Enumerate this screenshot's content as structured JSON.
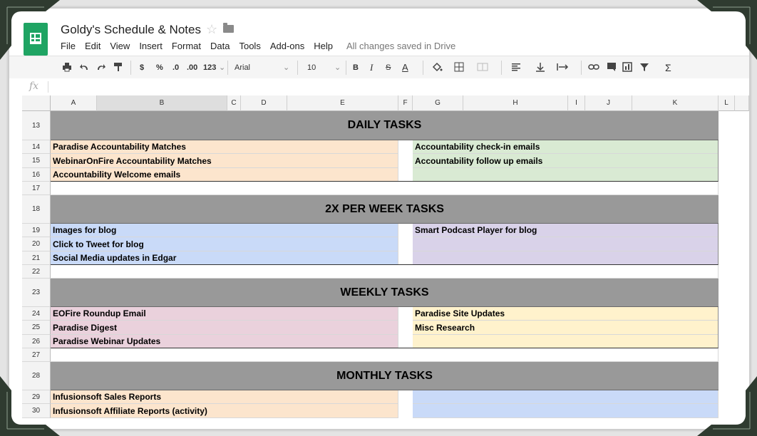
{
  "doc": {
    "title": "Goldy's Schedule & Notes",
    "saved_status": "All changes saved in Drive",
    "star": "☆"
  },
  "menu": [
    "File",
    "Edit",
    "View",
    "Insert",
    "Format",
    "Data",
    "Tools",
    "Add-ons",
    "Help"
  ],
  "toolbar": {
    "currency": "$",
    "percent": "%",
    "dec_less": ".0",
    "dec_more": ".00",
    "number_format": "123",
    "font": "Arial",
    "font_size": "10",
    "bold": "B",
    "italic": "I",
    "strike": "S",
    "text_color": "A",
    "sum": "Σ"
  },
  "formula_bar": {
    "fx": "fx",
    "value": ""
  },
  "columns": [
    "A",
    "B",
    "C",
    "D",
    "E",
    "F",
    "G",
    "H",
    "I",
    "J",
    "K",
    "L"
  ],
  "rows": {
    "r13": "13",
    "r14": "14",
    "r15": "15",
    "r16": "16",
    "r17": "17",
    "r18": "18",
    "r19": "19",
    "r20": "20",
    "r21": "21",
    "r22": "22",
    "r23": "23",
    "r24": "24",
    "r25": "25",
    "r26": "26",
    "r27": "27",
    "r28": "28",
    "r29": "29",
    "r30": "30"
  },
  "sections": {
    "daily": "DAILY TASKS",
    "twice_weekly": "2X PER WEEK TASKS",
    "weekly": "WEEKLY TASKS",
    "monthly": "MONTHLY TASKS"
  },
  "tasks": {
    "daily_left": [
      "Paradise Accountability Matches",
      "WebinarOnFire Accountability Matches",
      "Accountability Welcome emails"
    ],
    "daily_right": [
      "Accountability check-in emails",
      "Accountability follow up emails",
      ""
    ],
    "twice_left": [
      "Images for blog",
      "Click to Tweet for blog",
      "Social Media updates in Edgar"
    ],
    "twice_right": [
      "Smart Podcast Player for blog",
      "",
      ""
    ],
    "weekly_left": [
      "EOFire Roundup Email",
      "Paradise Digest",
      "Paradise Webinar Updates"
    ],
    "weekly_right": [
      "Paradise Site Updates",
      "Misc Research",
      ""
    ],
    "monthly_left": [
      "Infusionsoft Sales Reports",
      "Infusionsoft Affiliate Reports (activity)"
    ],
    "monthly_right": [
      "",
      ""
    ]
  },
  "colors": {
    "app_green": "#1fa463",
    "section_gray": "#999999",
    "orange": "#fce5cd",
    "green": "#d9ead3",
    "blue": "#c9daf8",
    "purple": "#d9d2e9",
    "pink": "#ead1dc",
    "yellow": "#fff2cc",
    "frame_corner": "#2f3b30"
  }
}
